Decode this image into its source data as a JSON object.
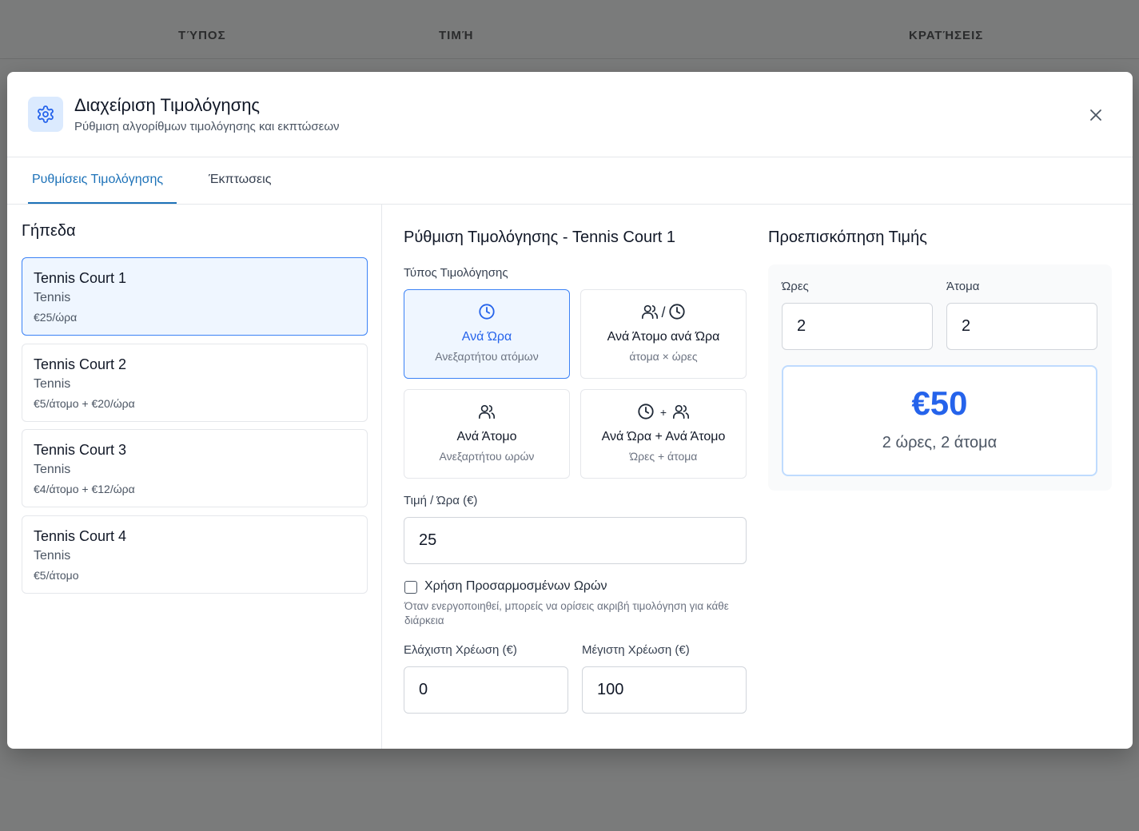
{
  "background": {
    "columns": [
      "ΤΎΠΟΣ",
      "ΤΙΜΉ",
      "ΚΡΑΤΉΣΕΙΣ"
    ]
  },
  "modal": {
    "title": "Διαχείριση Τιμολόγησης",
    "subtitle": "Ρύθμιση αλγορίθμων τιμολόγησης και εκπτώσεων",
    "tabs": [
      {
        "label": "Ρυθμίσεις Τιμολόγησης",
        "active": true
      },
      {
        "label": "Έκπτωσεις",
        "active": false
      }
    ]
  },
  "courts_panel": {
    "title": "Γήπεδα",
    "courts": [
      {
        "name": "Tennis Court 1",
        "sport": "Tennis",
        "price": "€25/ώρα",
        "selected": true
      },
      {
        "name": "Tennis Court 2",
        "sport": "Tennis",
        "price": "€5/άτομο + €20/ώρα",
        "selected": false
      },
      {
        "name": "Tennis Court 3",
        "sport": "Tennis",
        "price": "€4/άτομο + €12/ώρα",
        "selected": false
      },
      {
        "name": "Tennis Court 4",
        "sport": "Tennis",
        "price": "€5/άτομο",
        "selected": false
      }
    ]
  },
  "settings": {
    "title": "Ρύθμιση Τιμολόγησης - Tennis Court 1",
    "type_label": "Τύπος Τιμολόγησης",
    "types": [
      {
        "label": "Ανά Ώρα",
        "desc": "Ανεξαρτήτου ατόμων",
        "icons": [
          "clock-icon"
        ],
        "selected": true
      },
      {
        "label": "Ανά Άτομο ανά Ώρα",
        "desc": "άτομα × ώρες",
        "separator": "/",
        "icons": [
          "users-icon",
          "clock-icon"
        ],
        "selected": false
      },
      {
        "label": "Ανά Άτομο",
        "desc": "Ανεξαρτήτου ωρών",
        "icons": [
          "users-icon"
        ],
        "selected": false
      },
      {
        "label": "Ανά Ώρα + Ανά Άτομο",
        "desc": "Ώρες + άτομα",
        "separator": "+",
        "icons": [
          "clock-icon",
          "users-icon"
        ],
        "selected": false
      }
    ],
    "price_per_hour_label": "Τιμή / Ώρα (€)",
    "price_per_hour_value": "25",
    "custom_hours_label": "Χρήση Προσαρμοσμένων Ωρών",
    "custom_hours_checked": false,
    "custom_hours_help": "Όταν ενεργοποιηθεί, μπορείς να ορίσεις ακριβή τιμολόγηση για κάθε διάρκεια",
    "min_charge_label": "Ελάχιστη Χρέωση (€)",
    "min_charge_value": "0",
    "max_charge_label": "Μέγιστη Χρέωση (€)",
    "max_charge_value": "100"
  },
  "preview": {
    "title": "Προεπισκόπηση Τιμής",
    "hours_label": "Ώρες",
    "hours_value": "2",
    "people_label": "Άτομα",
    "people_value": "2",
    "price": "€50",
    "summary": "2 ώρες, 2 άτομα"
  },
  "colors": {
    "accent": "#2563eb",
    "tab_accent": "#1d72b8",
    "selected_bg": "#eff6ff",
    "overlay": "#7a7b7b"
  }
}
